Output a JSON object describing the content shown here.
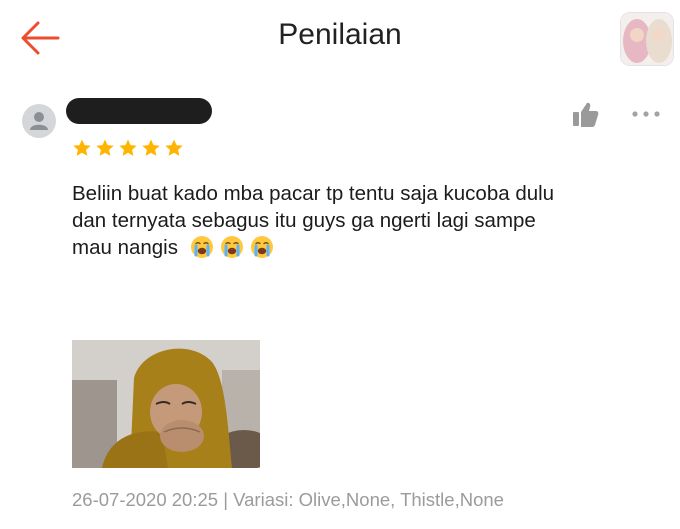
{
  "header": {
    "title": "Penilaian",
    "back_icon": "arrow-left-icon",
    "accent_color": "#ee4d2d"
  },
  "review": {
    "user_avatar_icon": "user-avatar-icon",
    "rating": 5,
    "star_color": "#ffb400",
    "text_lines": [
      "Beliin buat kado mba pacar tp tentu saja kucoba dulu",
      "dan ternyata sebagus itu guys ga ngerti lagi sampe",
      "mau nangis"
    ],
    "emojis": [
      "loudly-crying-face-emoji",
      "loudly-crying-face-emoji",
      "loudly-crying-face-emoji"
    ],
    "date": "26-07-2020 20:25",
    "separator": " | ",
    "variation": "Variasi: Olive,None, Thistle,None"
  },
  "actions": {
    "like_icon": "thumbs-up-icon",
    "more_icon": "more-dots-icon"
  }
}
